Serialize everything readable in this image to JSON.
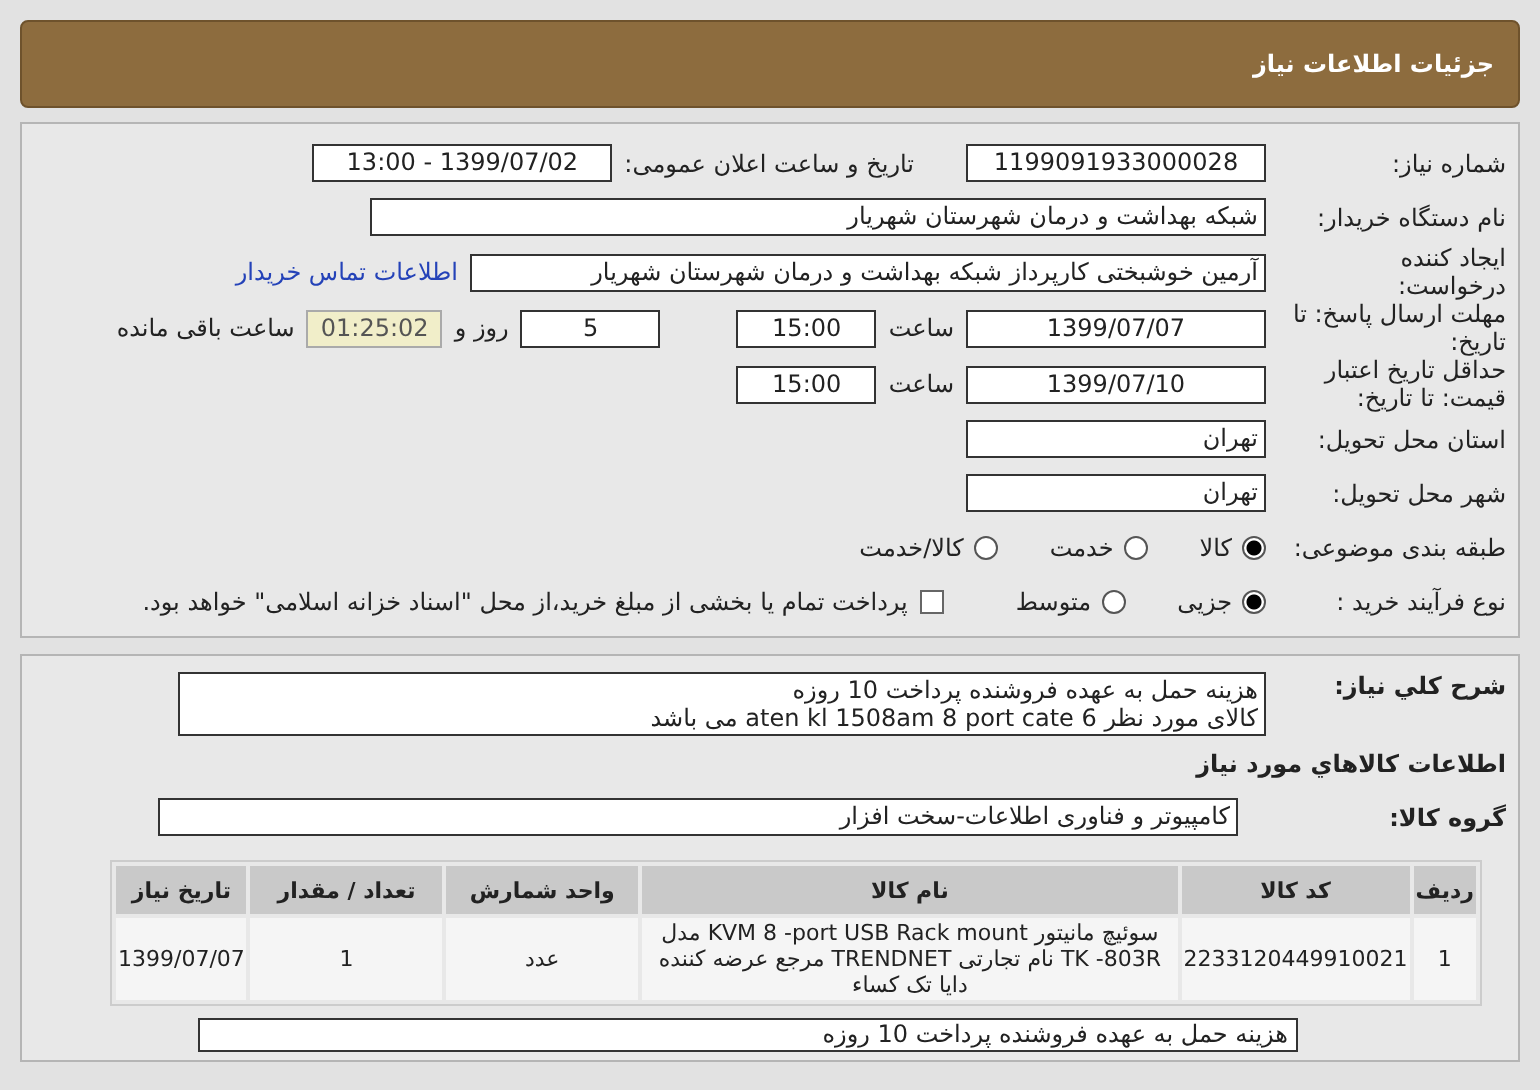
{
  "header": {
    "title": "جزئیات اطلاعات نیاز"
  },
  "need_number": {
    "label": "شماره نیاز:",
    "value": "1199091933000028"
  },
  "announce": {
    "label": "تاریخ و ساعت اعلان عمومی:",
    "value": "1399/07/02 - 13:00"
  },
  "buyer": {
    "label": "نام دستگاه خریدار:",
    "value": "شبکه بهداشت و درمان شهرستان شهریار"
  },
  "creator": {
    "label": "ایجاد کننده درخواست:",
    "value": "آرمین خوشبختی کارپرداز شبکه بهداشت و درمان شهرستان شهریار",
    "link": "اطلاعات تماس خریدار"
  },
  "deadline": {
    "label": "مهلت ارسال پاسخ: تا تاریخ:",
    "date": "1399/07/07",
    "time_label": "ساعت",
    "time": "15:00",
    "days": "5",
    "days_label": "روز و",
    "remaining": "01:25:02",
    "remaining_label": "ساعت باقی مانده"
  },
  "validity": {
    "label": "حداقل تاریخ اعتبار قیمت: تا تاریخ:",
    "date": "1399/07/10",
    "time_label": "ساعت",
    "time": "15:00"
  },
  "province": {
    "label": "استان محل تحویل:",
    "value": "تهران"
  },
  "city": {
    "label": "شهر محل تحویل:",
    "value": "تهران"
  },
  "category": {
    "label": "طبقه بندی موضوعی:",
    "options": [
      {
        "label": "کالا",
        "selected": true
      },
      {
        "label": "خدمت",
        "selected": false
      },
      {
        "label": "کالا/خدمت",
        "selected": false
      }
    ]
  },
  "process": {
    "label": "نوع فرآیند خرید :",
    "options": [
      {
        "label": "جزیی",
        "selected": true
      },
      {
        "label": "متوسط",
        "selected": false
      }
    ],
    "payment": {
      "label": "پرداخت تمام یا بخشی از مبلغ خرید،از محل \"اسناد خزانه اسلامی\" خواهد بود.",
      "checked": false
    }
  },
  "description": {
    "label": "شرح کلي نياز:",
    "lines": [
      "هزینه حمل به عهده فروشنده پرداخت 10 روزه",
      "کالای مورد نظر aten kl 1508am 8 port cate 6  می باشد"
    ]
  },
  "goods_title": "اطلاعات کالاهاي مورد نياز",
  "group": {
    "label": "گروه کالا:",
    "value": "کامپیوتر و فناوری اطلاعات-سخت افزار"
  },
  "table": {
    "columns": [
      "ردیف",
      "کد کالا",
      "نام کالا",
      "واحد شمارش",
      "تعداد / مقدار",
      "تاریخ نیاز"
    ],
    "rows": [
      [
        "1",
        "2233120449910021",
        "سوئیچ مانیتور KVM 8 -port USB Rack mount مدل TK -803R نام تجارتی TRENDNET مرجع عرضه کننده دایا تک کساء",
        "عدد",
        "1",
        "1399/07/07"
      ]
    ]
  },
  "note": {
    "value": "هزینه حمل به عهده فروشنده پرداخت 10 روزه"
  }
}
